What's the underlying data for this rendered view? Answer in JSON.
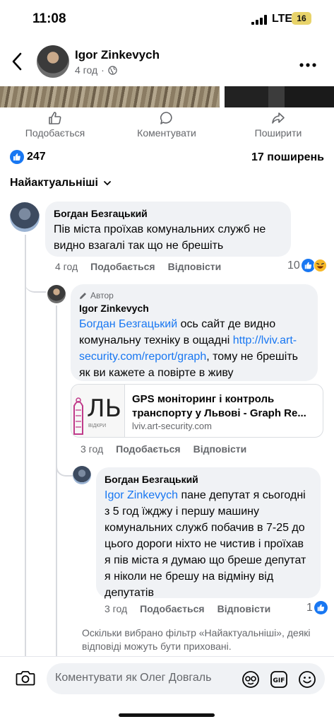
{
  "status_bar": {
    "time": "11:08",
    "network": "LTE",
    "battery": "16"
  },
  "header": {
    "author": "Igor Zinkevych",
    "age": "4 год",
    "separator": "·",
    "icons": {
      "back": "chevron-left-icon",
      "privacy": "globe-icon",
      "more": "more-dots-icon"
    }
  },
  "post_actions": {
    "like_label": "Подобається",
    "comment_label": "Коментувати",
    "share_label": "Поширити"
  },
  "reactions": {
    "likes": "247",
    "shares": "17 поширень"
  },
  "sort": {
    "label": "Найактуальніші"
  },
  "comments": [
    {
      "author": "Богдан Безгацький",
      "text": "Пів міста проїхав комунальних служб не видно взагалі так що не брешіть",
      "age": "4 год",
      "like_label": "Подобається",
      "reply_label": "Відповісти",
      "reaction_count": "10"
    }
  ],
  "reply_author": {
    "badge": "Автор",
    "author": "Igor Zinkevych",
    "mention": "Богдан Безгацький",
    "text_part1": " ось сайт де видно комунальну техніку в ощадні ",
    "link": "http://lviv.art-security.com/report/graph",
    "text_part2": ", тому не брешіть як ви кажете а повірте в живу",
    "age": "3 год",
    "like_label": "Подобається",
    "reply_label": "Відповісти"
  },
  "link_preview": {
    "title": "GPS моніторинг і контроль транспорту у Львові - Graph Re...",
    "domain": "lviv.art-security.com",
    "thumb_text": "ЛЬ",
    "thumb_sub": "ВІДКРИ"
  },
  "reply_bohdan": {
    "author": "Богдан Безгацький",
    "mention": "Igor Zinkevych",
    "text": " пане депутат я сьогодні з 5 год їжджу і першу машину комунальних служб побачив в 7-25 до цього дороги ніхто не чистив і проїхав я пів міста я думаю що бреше депутат я ніколи не брешу на відміну від депутатів",
    "age": "3 год",
    "like_label": "Подобається",
    "reply_label": "Відповісти",
    "reaction_count": "1"
  },
  "filter_note": "Оскільки вибрано фільтр «Найактуальніші», деякі відповіді можуть бути приховані.",
  "composer": {
    "placeholder": "Коментувати як Олег Довгаль"
  },
  "colors": {
    "accent": "#1877f2",
    "bubble": "#f0f2f5",
    "secondary_text": "#65676b"
  }
}
